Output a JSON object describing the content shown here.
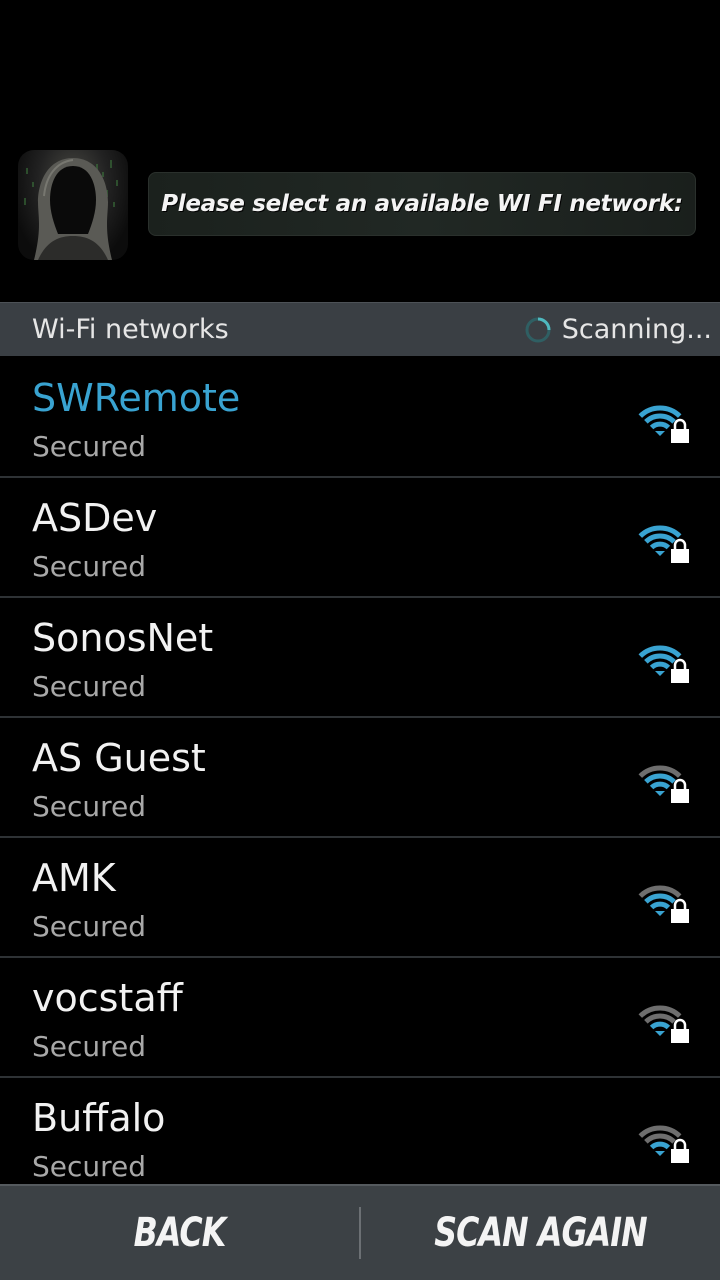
{
  "header": {
    "prompt": "Please select an available WI FI network:"
  },
  "section": {
    "title": "Wi-Fi networks",
    "status": "Scanning..."
  },
  "colors": {
    "accent": "#39a3d1",
    "signal_dim": "#6e6e6e"
  },
  "networks": [
    {
      "name": "SWRemote",
      "status": "Secured",
      "signal_bars": 4,
      "selected": true
    },
    {
      "name": "ASDev",
      "status": "Secured",
      "signal_bars": 4,
      "selected": false
    },
    {
      "name": "SonosNet",
      "status": "Secured",
      "signal_bars": 4,
      "selected": false
    },
    {
      "name": "AS Guest",
      "status": "Secured",
      "signal_bars": 3,
      "selected": false
    },
    {
      "name": "AMK",
      "status": "Secured",
      "signal_bars": 3,
      "selected": false
    },
    {
      "name": "vocstaff",
      "status": "Secured",
      "signal_bars": 2,
      "selected": false
    },
    {
      "name": "Buffalo",
      "status": "Secured",
      "signal_bars": 2,
      "selected": false
    }
  ],
  "buttons": {
    "back": "BACK",
    "scan_again": "SCAN AGAIN"
  }
}
